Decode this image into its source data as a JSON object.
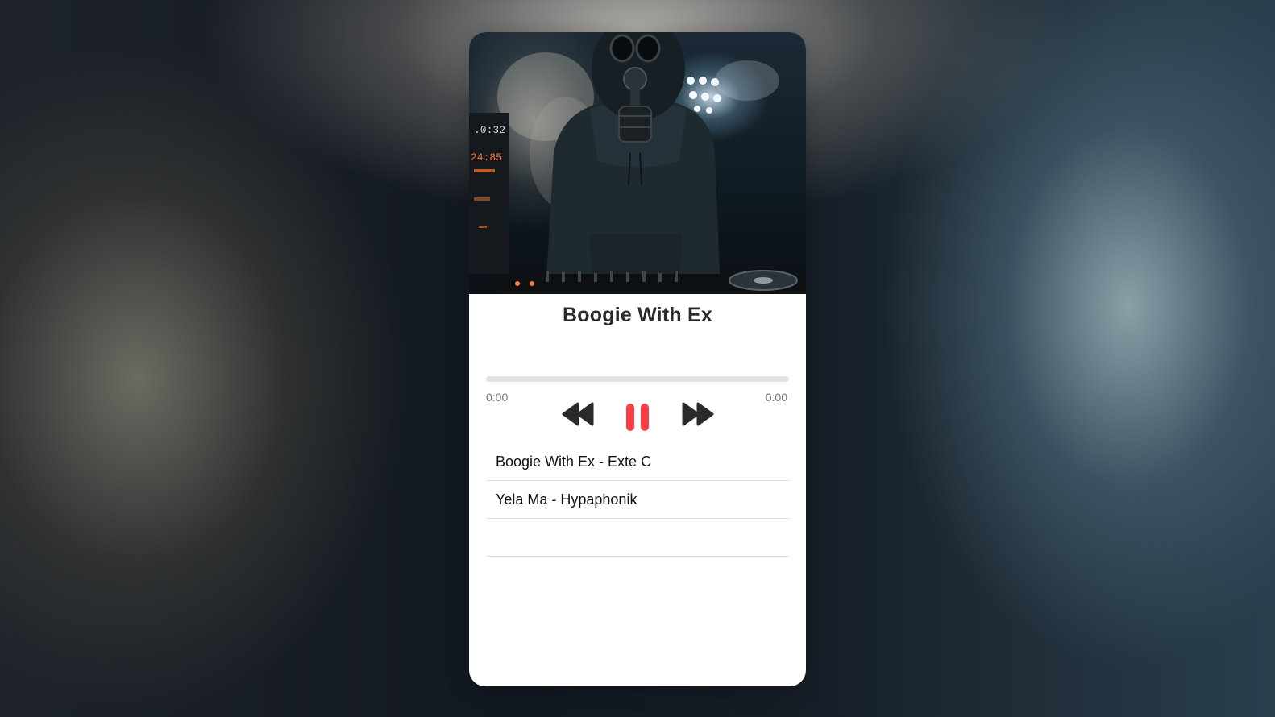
{
  "player": {
    "track_title": "Boogie With Ex",
    "current_time": "0:00",
    "duration": "0:00",
    "progress_fraction": 0,
    "accent_color": "#fc3c44",
    "controls": {
      "prev_icon": "rewind-icon",
      "play_pause_icon": "pause-icon",
      "next_icon": "fast-forward-icon"
    }
  },
  "cover_display": {
    "display_readout_1": ".0:32",
    "display_readout_2": "24:85"
  },
  "playlist": {
    "items": [
      {
        "label": "Boogie With Ex - Exte C"
      },
      {
        "label": "Yela Ma - Hypaphonik"
      },
      {
        "label": ""
      }
    ]
  }
}
